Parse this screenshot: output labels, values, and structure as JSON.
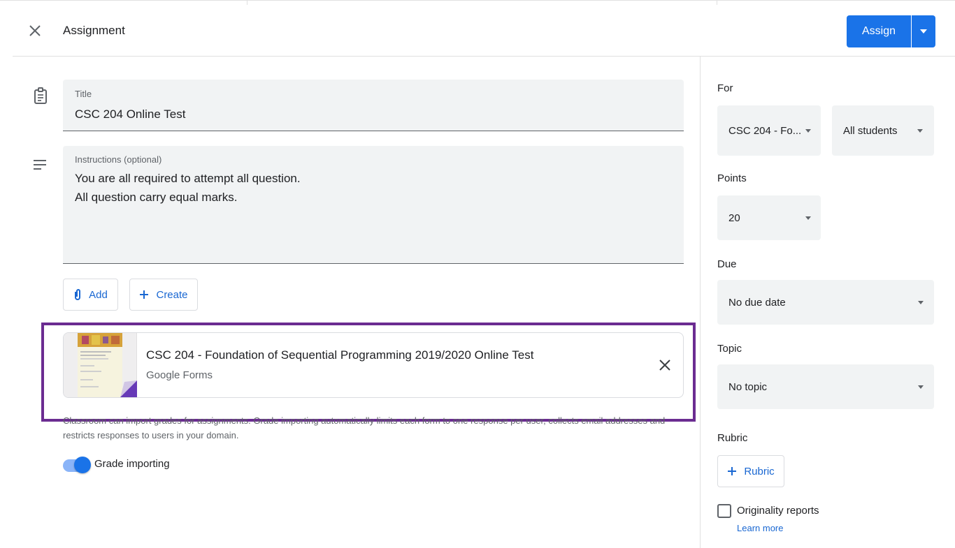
{
  "header": {
    "title": "Assignment",
    "assign_label": "Assign",
    "icons": {
      "close": "close-icon",
      "dropdown": "caret-down-icon"
    }
  },
  "form": {
    "title": {
      "label": "Title",
      "value": "CSC 204 Online Test",
      "icon": "assignment-icon"
    },
    "instructions": {
      "label": "Instructions (optional)",
      "value": "You are all required to attempt all question.\nAll question carry equal marks.",
      "icon": "notes-icon"
    },
    "add_label": "Add",
    "create_label": "Create"
  },
  "attachment": {
    "title": "CSC 204 - Foundation of Sequential Programming 2019/2020 Online Test",
    "subtitle": "Google Forms",
    "remove_icon": "close-icon"
  },
  "grading": {
    "helper": "Classroom can import grades for assignments. Grade importing automatically limits each form to one response per user, collects email addresses and restricts responses to users in your domain.",
    "toggle_label": "Grade importing",
    "toggle_on": true
  },
  "sidebar": {
    "for_label": "For",
    "class_value": "CSC 204 - Fo...",
    "students_value": "All students",
    "points_label": "Points",
    "points_value": "20",
    "due_label": "Due",
    "due_value": "No due date",
    "topic_label": "Topic",
    "topic_value": "No topic",
    "rubric_label": "Rubric",
    "rubric_button": "Rubric",
    "originality_label": "Originality reports",
    "learn_more": "Learn more",
    "originality_checked": false
  },
  "colors": {
    "accent": "#1a73e8",
    "highlight": "#6b2c91",
    "field_bg": "#f1f3f4"
  }
}
